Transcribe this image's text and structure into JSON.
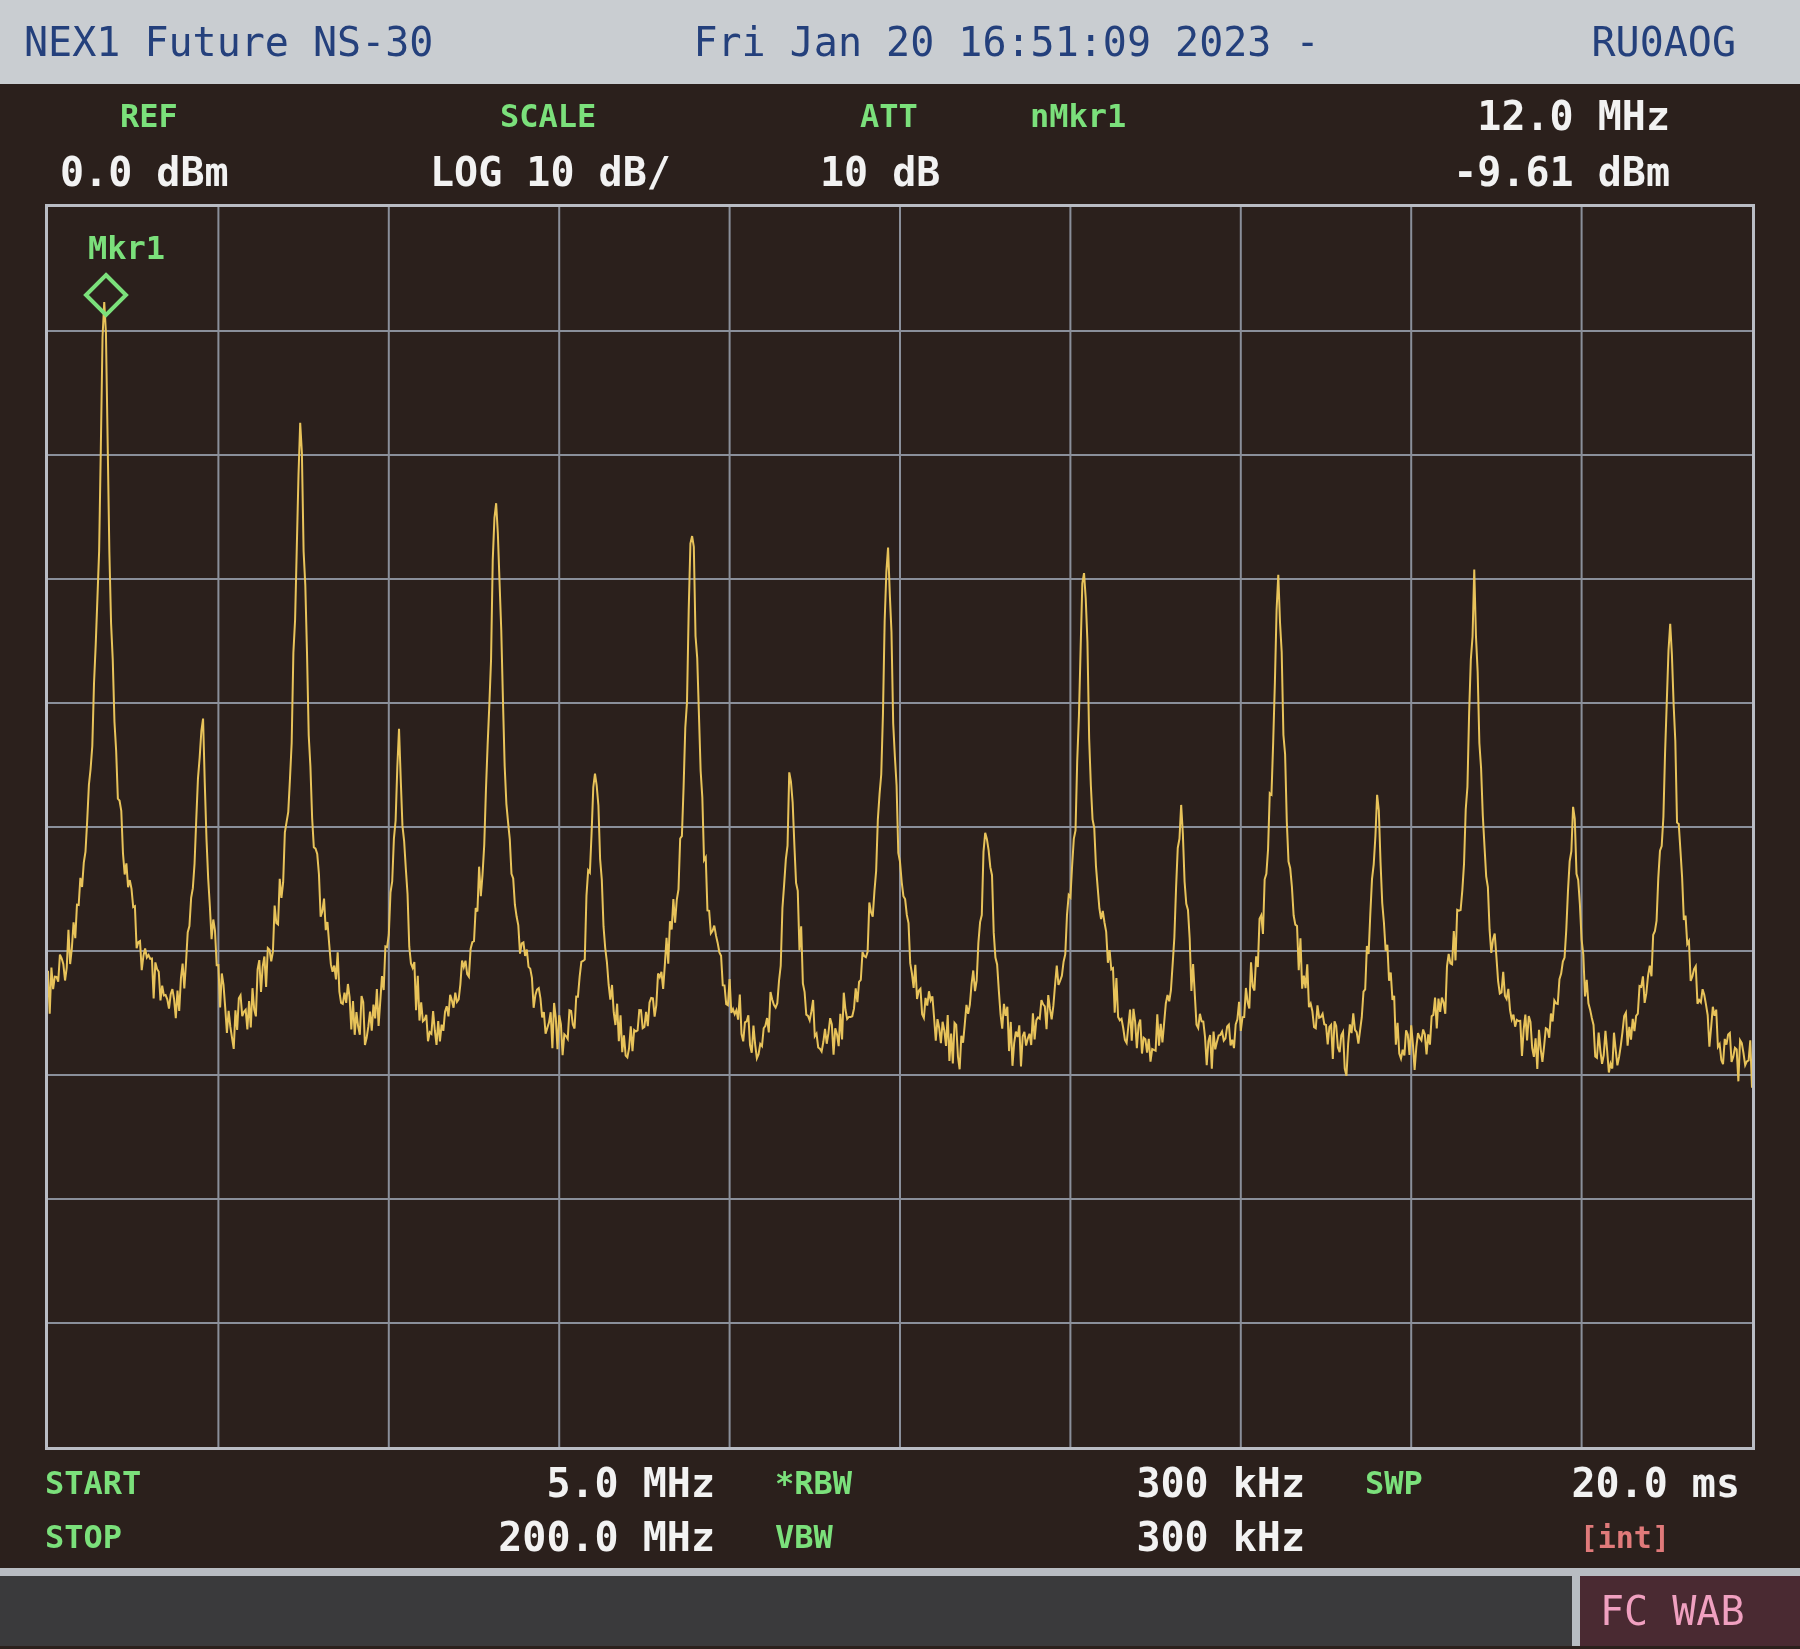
{
  "title_bar": {
    "model": "NEX1 Future NS-30",
    "datetime": "Fri Jan 20 16:51:09 2023 -",
    "callsign": "RU0AOG"
  },
  "header": [
    {
      "label": "REF",
      "value": "0.0 dBm"
    },
    {
      "label": "SCALE",
      "value": "LOG 10 dB/"
    },
    {
      "label": "ATT",
      "value": "10 dB"
    }
  ],
  "marker_readout": {
    "label": "nMkr1",
    "frequency": "12.0 MHz",
    "amplitude": "-9.61 dBm"
  },
  "plot": {
    "marker_label": "Mkr1"
  },
  "footer": [
    {
      "label": "START",
      "value": "5.0 MHz"
    },
    {
      "label": "*RBW",
      "value": "300 kHz"
    },
    {
      "label": "SWP",
      "value": "20.0 ms"
    },
    {
      "label": "STOP",
      "value": "200.0 MHz"
    },
    {
      "label": "VBW",
      "value": "300 kHz"
    },
    {
      "note": "[int]"
    }
  ],
  "status_bar": {
    "mode": "FC WAB"
  }
}
